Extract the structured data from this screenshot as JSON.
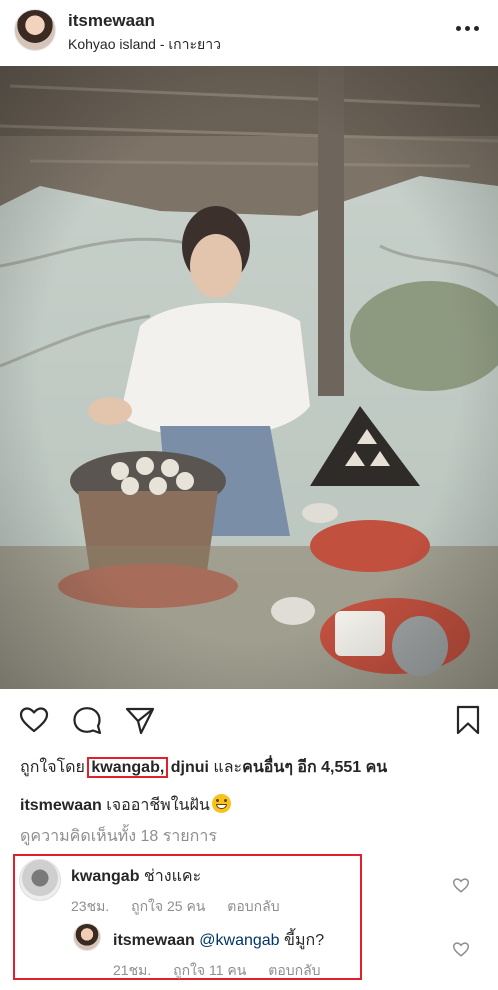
{
  "post": {
    "username": "itsmewaan",
    "location": "Kohyao island - เกาะยาว"
  },
  "actions": {
    "like_icon": "heart-outline-icon",
    "comment_icon": "comment-bubble-icon",
    "share_icon": "paper-plane-icon",
    "save_icon": "bookmark-icon"
  },
  "likes": {
    "prefix": "ถูกใจโดย",
    "user1": "kwangab,",
    "user2": "djnui",
    "middle": "และ",
    "others": "คนอื่นๆ อีก 4,551 คน"
  },
  "caption": {
    "username": "itsmewaan",
    "text": "เจออาชีพในฝัน"
  },
  "view_all_comments": "ดูความคิดเห็นทั้ง 18 รายการ",
  "comments": [
    {
      "username": "kwangab",
      "text": "ช่างแคะ",
      "time": "23ชม.",
      "likes": "ถูกใจ 25 คน",
      "reply": "ตอบกลับ"
    },
    {
      "username": "itsmewaan",
      "mention": "@kwangab",
      "text": "ขี้มูก?",
      "time": "21ชม.",
      "likes": "ถูกใจ 11 คน",
      "reply": "ตอบกลับ"
    }
  ],
  "colors": {
    "highlight_box": "#e0202a",
    "text": "#262626",
    "muted": "#8e8e8e",
    "mention": "#003569"
  }
}
